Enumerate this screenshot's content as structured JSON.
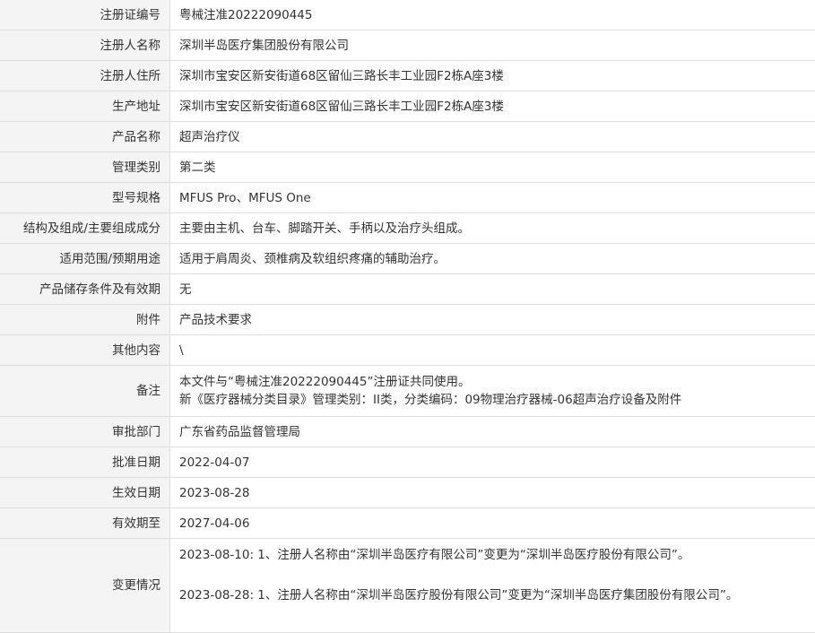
{
  "rows": [
    {
      "label": "注册证编号",
      "value": "粤械注准20222090445"
    },
    {
      "label": "注册人名称",
      "value": "深圳半岛医疗集团股份有限公司"
    },
    {
      "label": "注册人住所",
      "value": "深圳市宝安区新安街道68区留仙三路长丰工业园F2栋A座3楼"
    },
    {
      "label": "生产地址",
      "value": "深圳市宝安区新安街道68区留仙三路长丰工业园F2栋A座3楼"
    },
    {
      "label": "产品名称",
      "value": "超声治疗仪"
    },
    {
      "label": "管理类别",
      "value": "第二类"
    },
    {
      "label": "型号规格",
      "value": "MFUS Pro、MFUS One"
    },
    {
      "label": "结构及组成/主要组成成分",
      "value": "主要由主机、台车、脚踏开关、手柄以及治疗头组成。"
    },
    {
      "label": "适用范围/预期用途",
      "value": "适用于肩周炎、颈椎病及软组织疼痛的辅助治疗。"
    },
    {
      "label": "产品储存条件及有效期",
      "value": "无"
    },
    {
      "label": "附件",
      "value": "产品技术要求"
    },
    {
      "label": "其他内容",
      "value": "\\"
    }
  ],
  "remarks": {
    "label": "备注",
    "line1": "本文件与“粤械注准20222090445”注册证共同使用。",
    "line2": "新《医疗器械分类目录》管理类别：II类，分类编码：09物理治疗器械-06超声治疗设备及附件"
  },
  "rows2": [
    {
      "label": "审批部门",
      "value": "广东省药品监督管理局"
    },
    {
      "label": "批准日期",
      "value": "2022-04-07"
    },
    {
      "label": "生效日期",
      "value": "2023-08-28"
    },
    {
      "label": "有效期至",
      "value": "2027-04-06"
    }
  ],
  "changes": {
    "label": "变更情况",
    "items": [
      "2023-08-10: 1、注册人名称由“深圳半岛医疗有限公司”变更为“深圳半岛医疗股份有限公司”。",
      "2023-08-28: 1、注册人名称由“深圳半岛医疗股份有限公司”变更为“深圳半岛医疗集团股份有限公司”。"
    ]
  }
}
